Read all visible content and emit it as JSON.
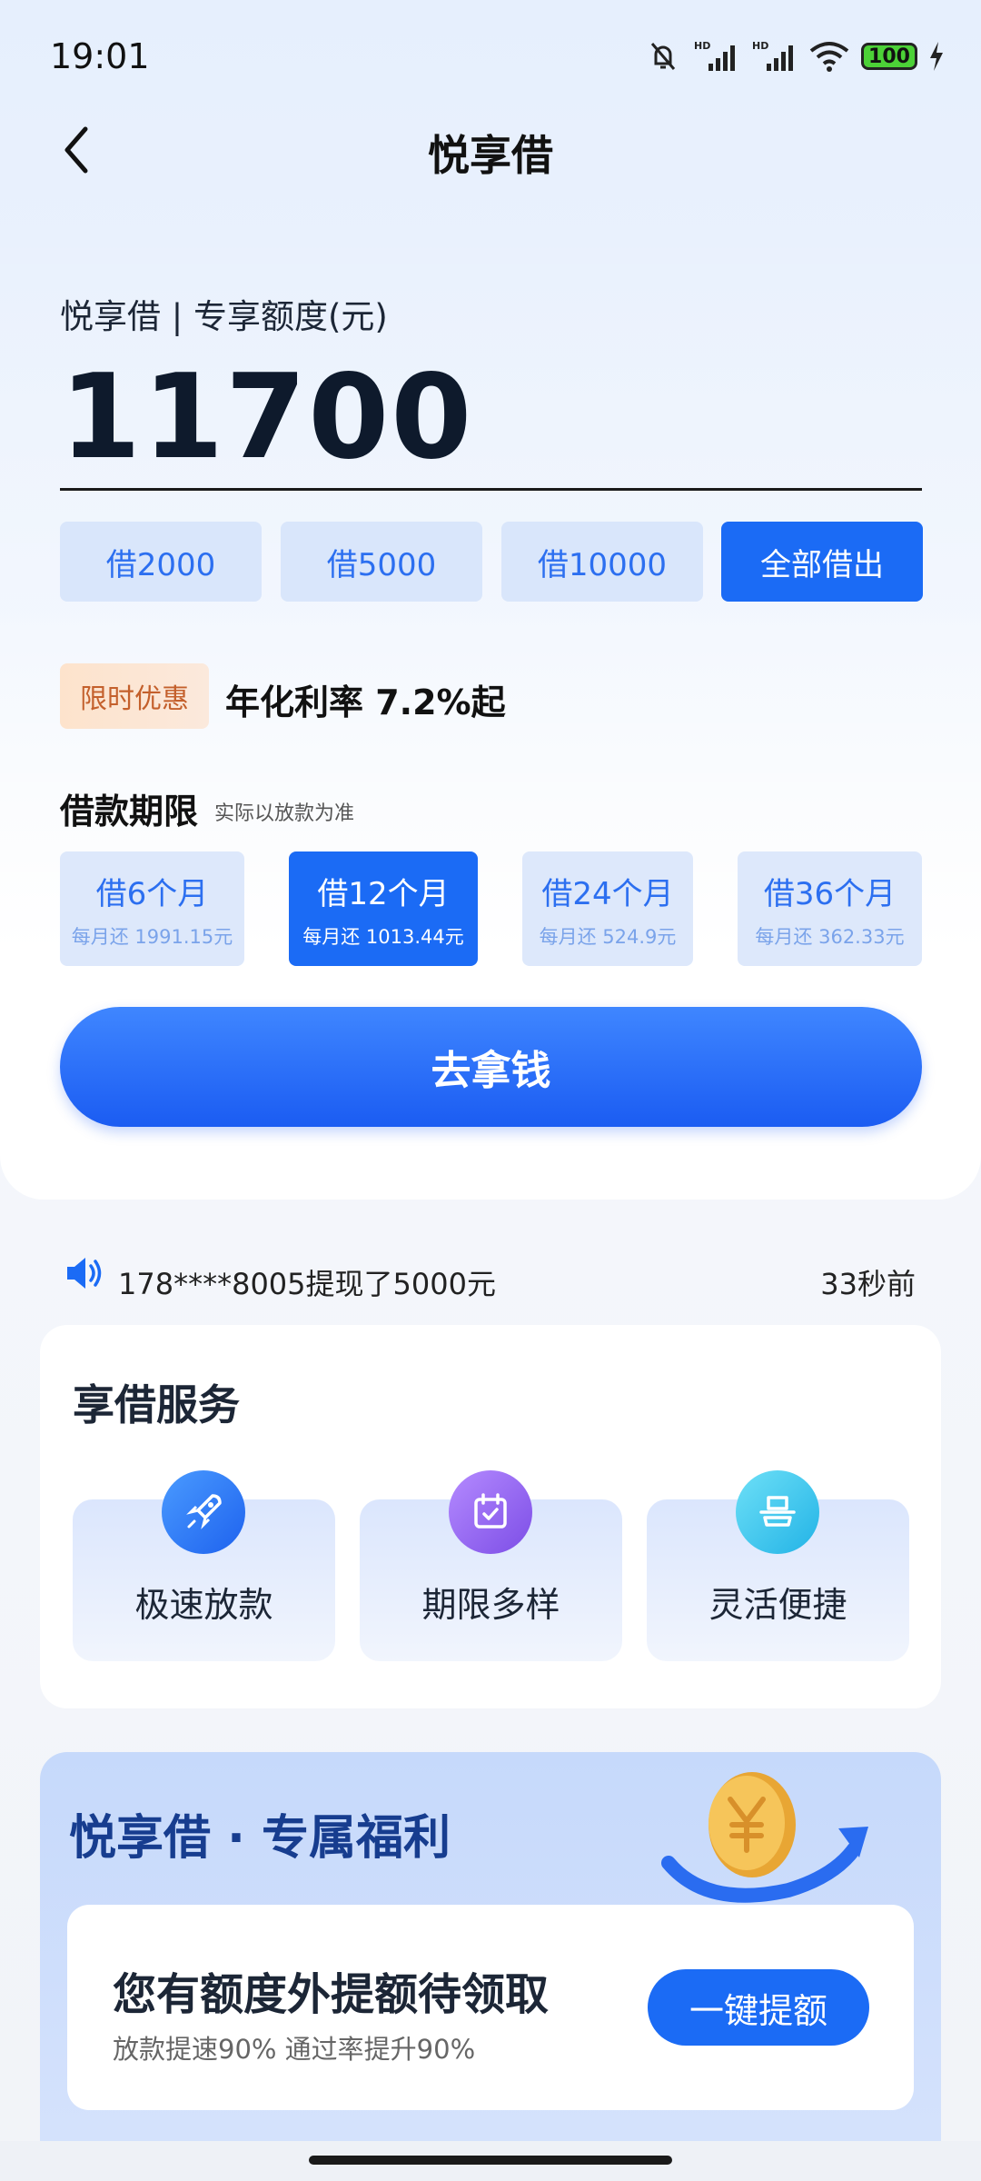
{
  "status_bar": {
    "time": "19:01",
    "battery": "100",
    "icons": [
      "bell-mute-icon",
      "signal-hd-icon",
      "signal-hd-icon",
      "wifi-icon",
      "battery-icon",
      "charging-icon"
    ]
  },
  "header": {
    "title": "悦享借",
    "back_icon": "chevron-left-icon"
  },
  "quota": {
    "label": "悦享借 | 专享额度(元)",
    "amount": "11700"
  },
  "amount_options": [
    {
      "label": "借2000",
      "selected": false
    },
    {
      "label": "借5000",
      "selected": false
    },
    {
      "label": "借10000",
      "selected": false
    },
    {
      "label": "全部借出",
      "selected": true
    }
  ],
  "promo": {
    "tag": "限时优惠",
    "rate_text": "年化利率 7.2%起"
  },
  "term": {
    "title": "借款期限",
    "note": "实际以放款为准",
    "options": [
      {
        "label": "借6个月",
        "monthly": "每月还 1991.15元",
        "selected": false
      },
      {
        "label": "借12个月",
        "monthly": "每月还 1013.44元",
        "selected": true
      },
      {
        "label": "借24个月",
        "monthly": "每月还 524.9元",
        "selected": false
      },
      {
        "label": "借36个月",
        "monthly": "每月还 362.33元",
        "selected": false
      }
    ]
  },
  "cta": {
    "label": "去拿钱"
  },
  "ticker": {
    "icon": "speaker-icon",
    "text": "178****8005提现了5000元",
    "time": "33秒前"
  },
  "services": {
    "title": "享借服务",
    "items": [
      {
        "label": "极速放款",
        "icon": "rocket-icon",
        "color": "#2f7df5"
      },
      {
        "label": "期限多样",
        "icon": "calendar-icon",
        "color": "#9c6bf0"
      },
      {
        "label": "灵活便捷",
        "icon": "stack-icon",
        "color": "#3fc6ef"
      }
    ]
  },
  "benefit": {
    "title": "悦享借 · 专属福利",
    "coin_icon": "yuan-coin-icon",
    "offer_title": "您有额度外提额待领取",
    "offer_sub": "放款提速90% 通过率提升90%",
    "button": "一键提额"
  },
  "colors": {
    "primary": "#1b6bf5",
    "chip_bg": "#d9e6fb",
    "promo_text": "#c4602c",
    "benefit_title": "#173d8f"
  }
}
